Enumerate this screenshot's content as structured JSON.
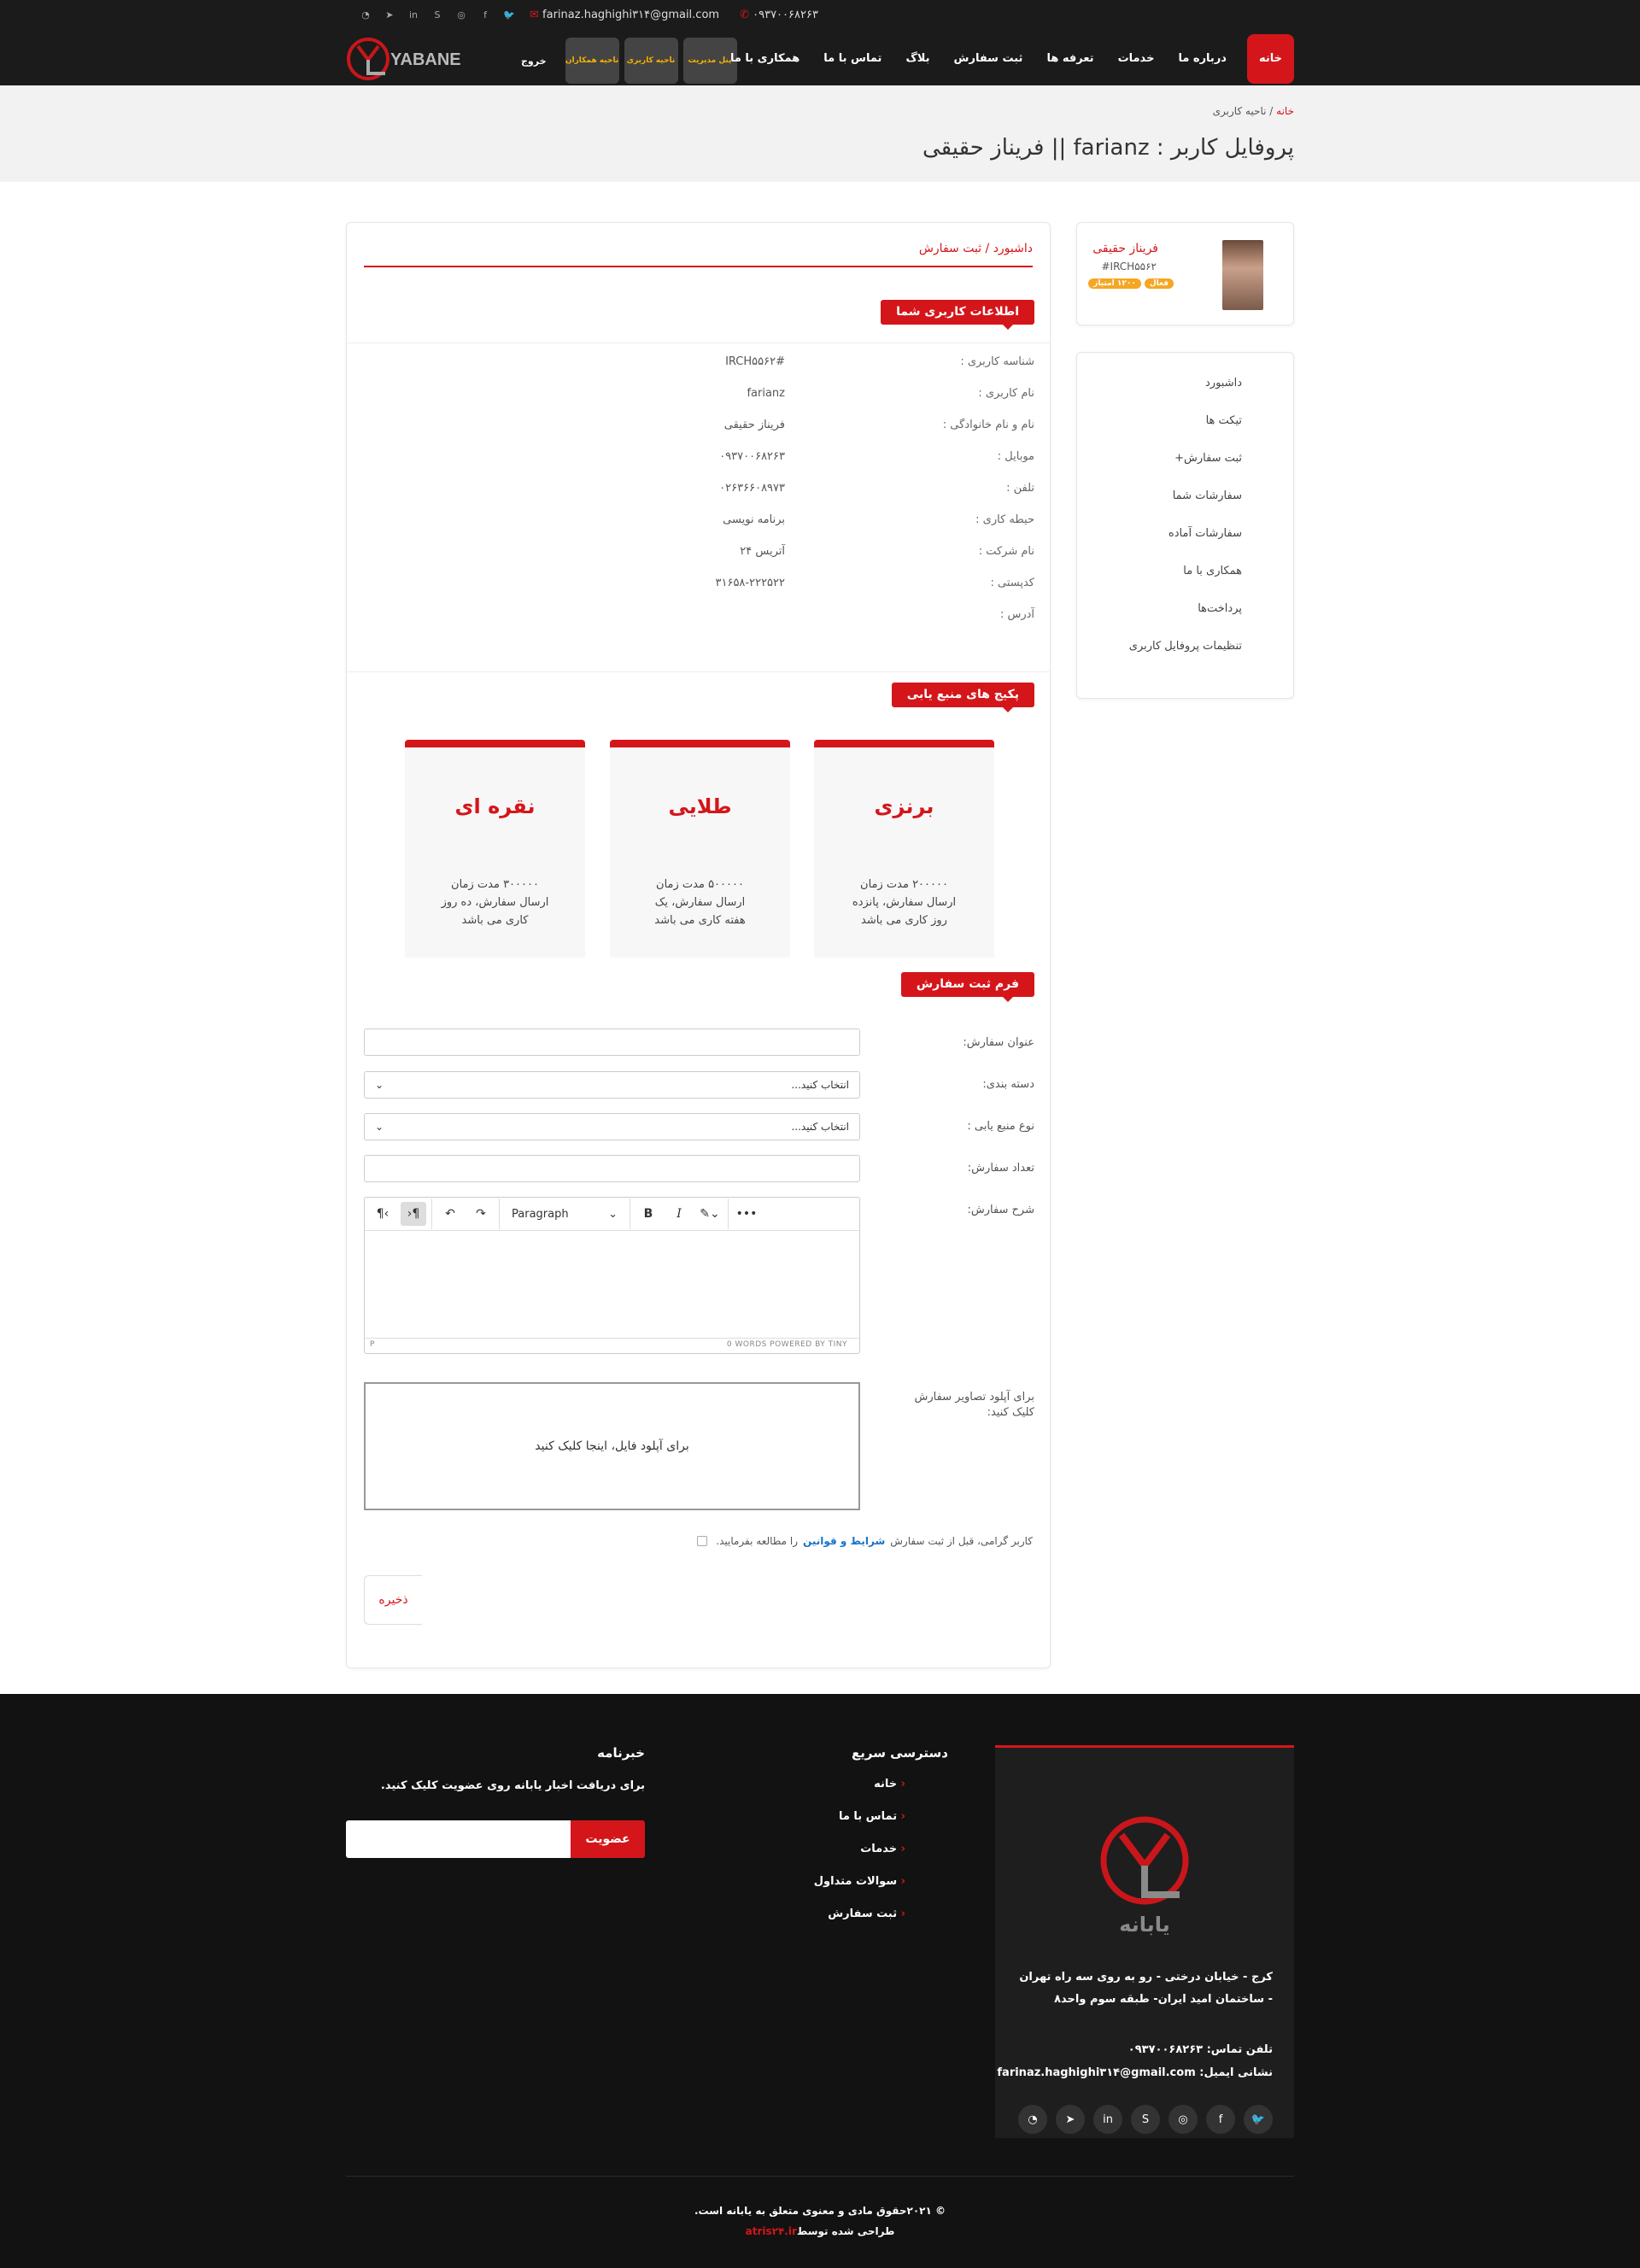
{
  "topbar": {
    "phone": "۰۹۳۷۰۰۶۸۲۶۳",
    "email": "farinaz.haghighi۳۱۴@gmail.com"
  },
  "brand": {
    "logo_text": "YABANE",
    "accent": "#d4161b"
  },
  "auth": {
    "logout": "خروج",
    "partner_area": "ناحیه همکاران",
    "user_area": "ناحیه کاربری",
    "admin_panel": "پنل مدیریت"
  },
  "nav": [
    "خانه",
    "درباره ما",
    "خدمات",
    "تعرفه ها",
    "ثبت سفارش",
    "بلاگ",
    "تماس با ما",
    "همکاری با ما"
  ],
  "breadcrumb": {
    "home": "خانه",
    "sep": " / ",
    "current": "ناحیه کاربری"
  },
  "page_title": "پروفایل کاربر : farianz || فریناز حقیقی",
  "profile": {
    "name": "فریناز حقیقی",
    "id": "#IRCH۵۵۶۲",
    "badge_status": "فعال",
    "badge_points": "۱۲۰۰ امتیاز"
  },
  "sidebar": [
    "داشبورد",
    "تیکت ها",
    "ثبت سفارش+",
    "سفارشات شما",
    "سفارشات آماده",
    "همکاری با ما",
    "پرداخت‌ها",
    "تنظیمات پروفایل کاربری"
  ],
  "content": {
    "crumb": "داشبورد / ثبت سفارش",
    "info_title": "اطلاعات کاربری شما",
    "info": [
      {
        "k": "شناسه کاربری :",
        "v": "#IRCH۵۵۶۲"
      },
      {
        "k": "نام کاربری :",
        "v": "farianz"
      },
      {
        "k": "نام و نام خانوادگی :",
        "v": "فریناز حقیقی"
      },
      {
        "k": "موبایل :",
        "v": "۰۹۳۷۰۰۶۸۲۶۳"
      },
      {
        "k": "تلفن :",
        "v": "۰۲۶۳۶۶۰۸۹۷۳"
      },
      {
        "k": "حیطه کاری :",
        "v": "برنامه نویسی"
      },
      {
        "k": "نام شرکت :",
        "v": "آتریس ۲۴"
      },
      {
        "k": "کدپستی :",
        "v": "۳۱۶۵۸-۲۲۲۵۲۲"
      },
      {
        "k": "آدرس :",
        "v": ""
      }
    ],
    "packages_title": "پکیج های منبع یابی",
    "packages": [
      {
        "title": "برنزی",
        "desc": "۲۰۰۰۰۰ مدت زمان ارسال سفارش، پانزده روز کاری می باشد"
      },
      {
        "title": "طلایی",
        "desc": "۵۰۰۰۰۰ مدت زمان ارسال سفارش، یک هفته کاری می باشد"
      },
      {
        "title": "نقره ای",
        "desc": "۳۰۰۰۰۰ مدت زمان ارسال سفارش، ده روز کاری می باشد"
      }
    ],
    "form_title": "فرم ثبت سفارش",
    "form": {
      "order_title_label": "عنوان سفارش:",
      "category_label": "دسته بندی:",
      "category_value": "انتخاب کنید...",
      "source_type_label": "نوع منبع یابی :",
      "source_type_value": "انتخاب کنید...",
      "count_label": "تعداد سفارش:",
      "desc_label": "شرح سفارش:",
      "editor_format": "Paragraph",
      "editor_path": "P",
      "editor_status": "0 WORDS  POWERED BY TINY",
      "upload_label": "برای آپلود تصاویر سفارش کلیک کنید:",
      "upload_text": "برای آپلود فایل، اینجا کلیک کنید",
      "terms_pre": "کاربر گرامی، قبل از ثبت سفارش",
      "terms_link": "شرایط و قوانین",
      "terms_post": "را مطالعه بفرمایید.",
      "save": "ذخیره"
    }
  },
  "footer": {
    "logo_text": "یابانه",
    "address": "کرج - خیابان درختی - رو به روی سه راه تهران - ساختمان امید ایران- طبقه سوم واحد۸",
    "phone": "تلفن تماس: ۰۹۳۷۰۰۶۸۲۶۳",
    "email": "نشانی ایمیل: farinaz.haghighi۳۱۴@gmail.com",
    "quick_title": "دسترسی سریع",
    "quick": [
      "خانه",
      "تماس با ما",
      "خدمات",
      "سوالات متداول",
      "ثبت سفارش"
    ],
    "news_title": "خبرنامه",
    "news_text": "برای دریافت اخبار یابانه روی عضویت کلیک کنید.",
    "subscribe": "عضویت",
    "copyright": "© ۲۰۲۱حقوق مادی و معنوی متعلق به یابانه است.",
    "designed_by": "طراحی شده توسط",
    "designer": "atris۲۴.ir"
  }
}
